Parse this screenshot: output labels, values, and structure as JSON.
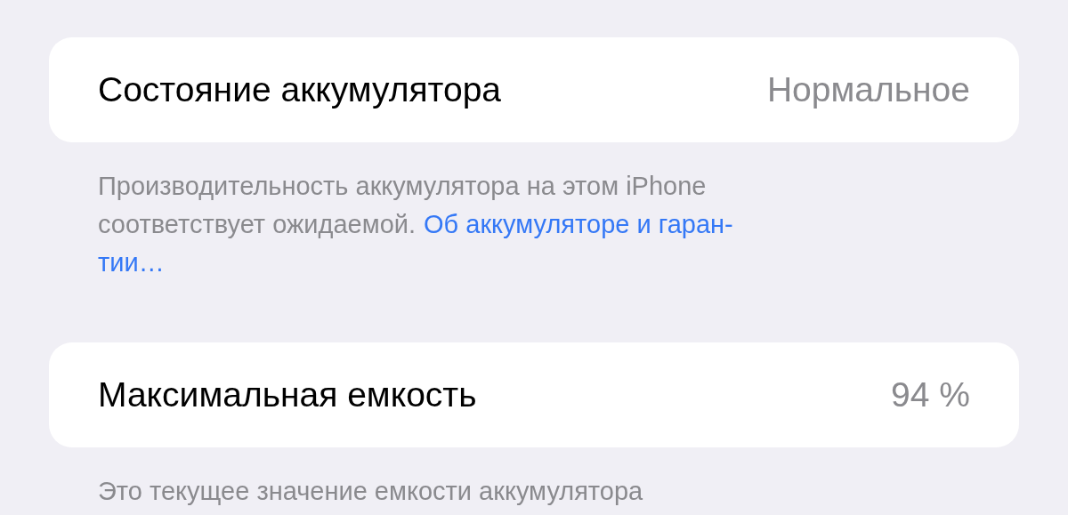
{
  "sections": [
    {
      "row": {
        "label": "Состояние аккумулятора",
        "value": "Нормальное"
      },
      "footer": {
        "lines": [
          [
            {
              "kind": "text",
              "text": "Производительность аккумулятора на этом iPhone"
            }
          ],
          [
            {
              "kind": "text",
              "text": "соответствует ожидаемой."
            },
            {
              "kind": "link",
              "text": "Об аккумуляторе и гаран-"
            }
          ],
          [
            {
              "kind": "link",
              "text": "тии…"
            }
          ]
        ]
      }
    },
    {
      "row": {
        "label": "Максимальная емкость",
        "value": "94 %"
      },
      "footer": {
        "lines": [
          [
            {
              "kind": "text",
              "text": "Это текущее значение емкости аккумулятора"
            }
          ]
        ]
      }
    }
  ]
}
